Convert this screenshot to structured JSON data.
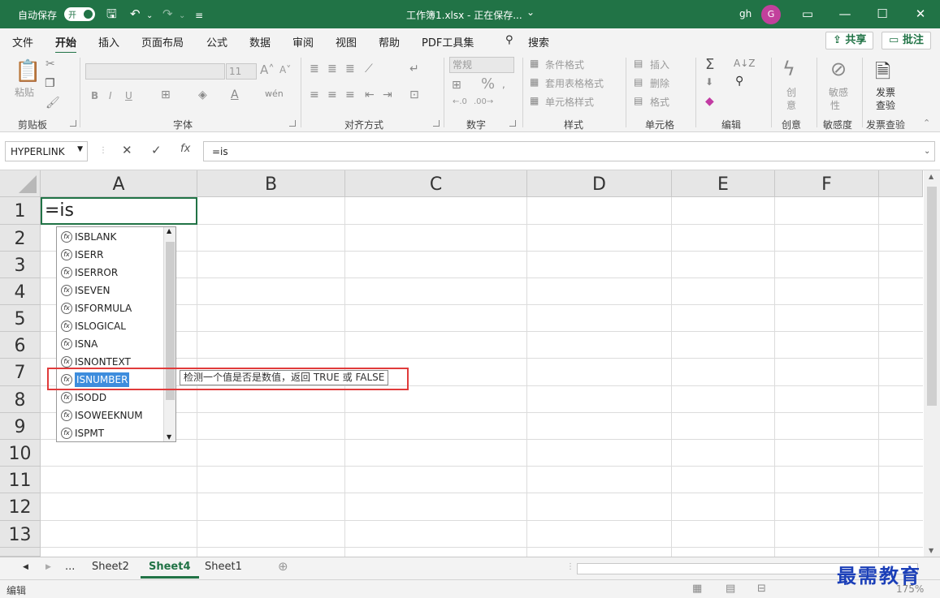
{
  "titlebar": {
    "autosave_label": "自动保存",
    "toggle_state": "开",
    "doc_title": "工作簿1.xlsx - 正在保存...",
    "title_caret": "⌄",
    "user": "gh",
    "avatar_initial": "G"
  },
  "menu": {
    "tabs": [
      "文件",
      "开始",
      "插入",
      "页面布局",
      "公式",
      "数据",
      "审阅",
      "视图",
      "帮助",
      "PDF工具集"
    ],
    "search_label": "搜索",
    "share_label": "共享",
    "comment_label": "批注"
  },
  "ribbon": {
    "clipboard": {
      "paste": "粘贴",
      "group": "剪贴板"
    },
    "font": {
      "group": "字体",
      "size": "11",
      "bold": "B",
      "italic": "I",
      "underline": "U"
    },
    "alignment": {
      "group": "对齐方式"
    },
    "number": {
      "group": "数字",
      "format": "常规",
      "percent": "%"
    },
    "styles": {
      "group": "样式",
      "cond_format": "条件格式",
      "table_format": "套用表格格式",
      "cell_styles": "单元格样式"
    },
    "cells": {
      "group": "单元格",
      "insert": "插入",
      "delete": "删除",
      "format": "格式"
    },
    "editing": {
      "group": "编辑"
    },
    "creative": {
      "group": "创意",
      "label1": "创",
      "label2": "意"
    },
    "sensitivity": {
      "group": "敏感度",
      "label1": "敏感",
      "label2": "性"
    },
    "invoice": {
      "group": "发票查验",
      "label1": "发票",
      "label2": "查验"
    }
  },
  "formula_bar": {
    "name_box": "HYPERLINK",
    "cancel": "✕",
    "enter": "✓",
    "fx": "fx",
    "formula": "=is"
  },
  "grid": {
    "columns": [
      "A",
      "B",
      "C",
      "D",
      "E",
      "F"
    ],
    "rows": [
      "1",
      "2",
      "3",
      "4",
      "5",
      "6",
      "7",
      "8",
      "9",
      "10",
      "11",
      "12",
      "13"
    ],
    "active_cell_value": "=is"
  },
  "autocomplete": {
    "items": [
      "ISBLANK",
      "ISERR",
      "ISERROR",
      "ISEVEN",
      "ISFORMULA",
      "ISLOGICAL",
      "ISNA",
      "ISNONTEXT",
      "ISNUMBER",
      "ISODD",
      "ISOWEEKNUM",
      "ISPMT"
    ],
    "selected": "ISNUMBER",
    "tooltip": "检测一个值是否是数值，返回 TRUE 或 FALSE"
  },
  "sheets": {
    "ellipsis": "...",
    "tabs": [
      "Sheet2",
      "Sheet4",
      "Sheet1"
    ],
    "active": "Sheet4"
  },
  "status": {
    "mode": "编辑",
    "zoom": "175%",
    "watermark": "最需教育"
  },
  "colors": {
    "brand_green": "#217346",
    "selection_blue": "#3e8ddd",
    "highlight_red": "#e03b3b"
  }
}
